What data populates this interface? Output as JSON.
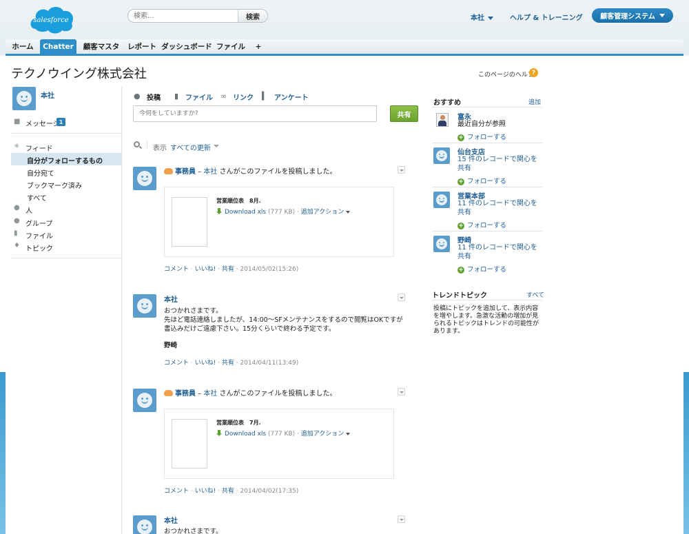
{
  "header": {
    "logo_text": "salesforce",
    "search_placeholder": "検索...",
    "search_button": "検索",
    "user_menu": "本社",
    "help_link": "ヘルプ & トレーニング",
    "app_switcher": "顧客管理システム"
  },
  "tabs": [
    "ホーム",
    "Chatter",
    "顧客マスタ",
    "レポート",
    "ダッシュボード",
    "ファイル",
    "+"
  ],
  "active_tab": "Chatter",
  "page": {
    "title": "テクノウイング株式会社",
    "help_text": "このページのヘルプ"
  },
  "left_nav": {
    "user_name": "本社",
    "messages_label": "メッセージ",
    "messages_count": "1",
    "feed_label": "フィード",
    "feed_items": [
      "自分がフォローするもの",
      "自分宛て",
      "ブックマーク済み",
      "すべて"
    ],
    "selected_feed": "自分がフォローするもの",
    "people_label": "人",
    "groups_label": "グループ",
    "files_label": "ファイル",
    "topics_label": "トピック"
  },
  "publisher": {
    "post": "投稿",
    "file": "ファイル",
    "link": "リンク",
    "poll": "アンケート",
    "placeholder": "今何をしていますか?",
    "share_button": "共有"
  },
  "filter": {
    "label": "表示",
    "value": "すべての更新"
  },
  "feed": [
    {
      "type": "file",
      "actor": "事務員",
      "sep": " – ",
      "target": "本社",
      "message": " さんがこのファイルを投稿しました。",
      "file_title": "営業順位表　8月.",
      "download": "Download xls",
      "size": " (777 KB)",
      "more_actions": "追加アクション",
      "comment": "コメント",
      "like": "いいね!",
      "share": "共有",
      "timestamp": "2014/05/02(15:26)"
    },
    {
      "type": "text",
      "author": "本社",
      "line1": "おつかれさまです。",
      "line2": "先ほど電話連絡しましたが、14:00～SFメンテナンスをするので閲覧はOKですが",
      "line3": "書込みだけご遠慮下さい。15分くらいで終わる予定です。",
      "signature": "野崎",
      "comment": "コメント",
      "like": "いいね!",
      "share": "共有",
      "timestamp": "2014/04/11(13:49)"
    },
    {
      "type": "file",
      "actor": "事務員",
      "sep": " – ",
      "target": "本社",
      "message": " さんがこのファイルを投稿しました。",
      "file_title": "営業順位表　7月.",
      "download": "Download xls",
      "size": " (777 KB)",
      "more_actions": "追加アクション",
      "comment": "コメント",
      "like": "いいね!",
      "share": "共有",
      "timestamp": "2014/04/02(17:35)"
    },
    {
      "type": "text",
      "author": "本社",
      "line1": "おつかれさまです。"
    }
  ],
  "recommendations": {
    "title": "おすすめ",
    "add_link": "追加",
    "follow_label": "フォローする",
    "items": [
      {
        "name": "富永",
        "desc1": "最近自分が参照",
        "desc2": ""
      },
      {
        "name": "仙台支店",
        "desc1": "15 件のレコードで関心を",
        "desc2": "共有"
      },
      {
        "name": "営業本部",
        "desc1": "11 件のレコードで関心を",
        "desc2": "共有"
      },
      {
        "name": "野崎",
        "desc1": "11 件のレコードで関心を",
        "desc2": "共有"
      }
    ]
  },
  "trending": {
    "title": "トレンドトピック",
    "all_link": "すべて",
    "text": "投稿にトピックを追加して、表示内容を増やします。急激な活動の増加が見られるトピックはトレンドの可能性があります。"
  },
  "colors": {
    "link": "#1f5f95",
    "tab_active": "#2e8ec9",
    "share_button": "#7ab03a",
    "avatar": "#5a9dcc"
  }
}
